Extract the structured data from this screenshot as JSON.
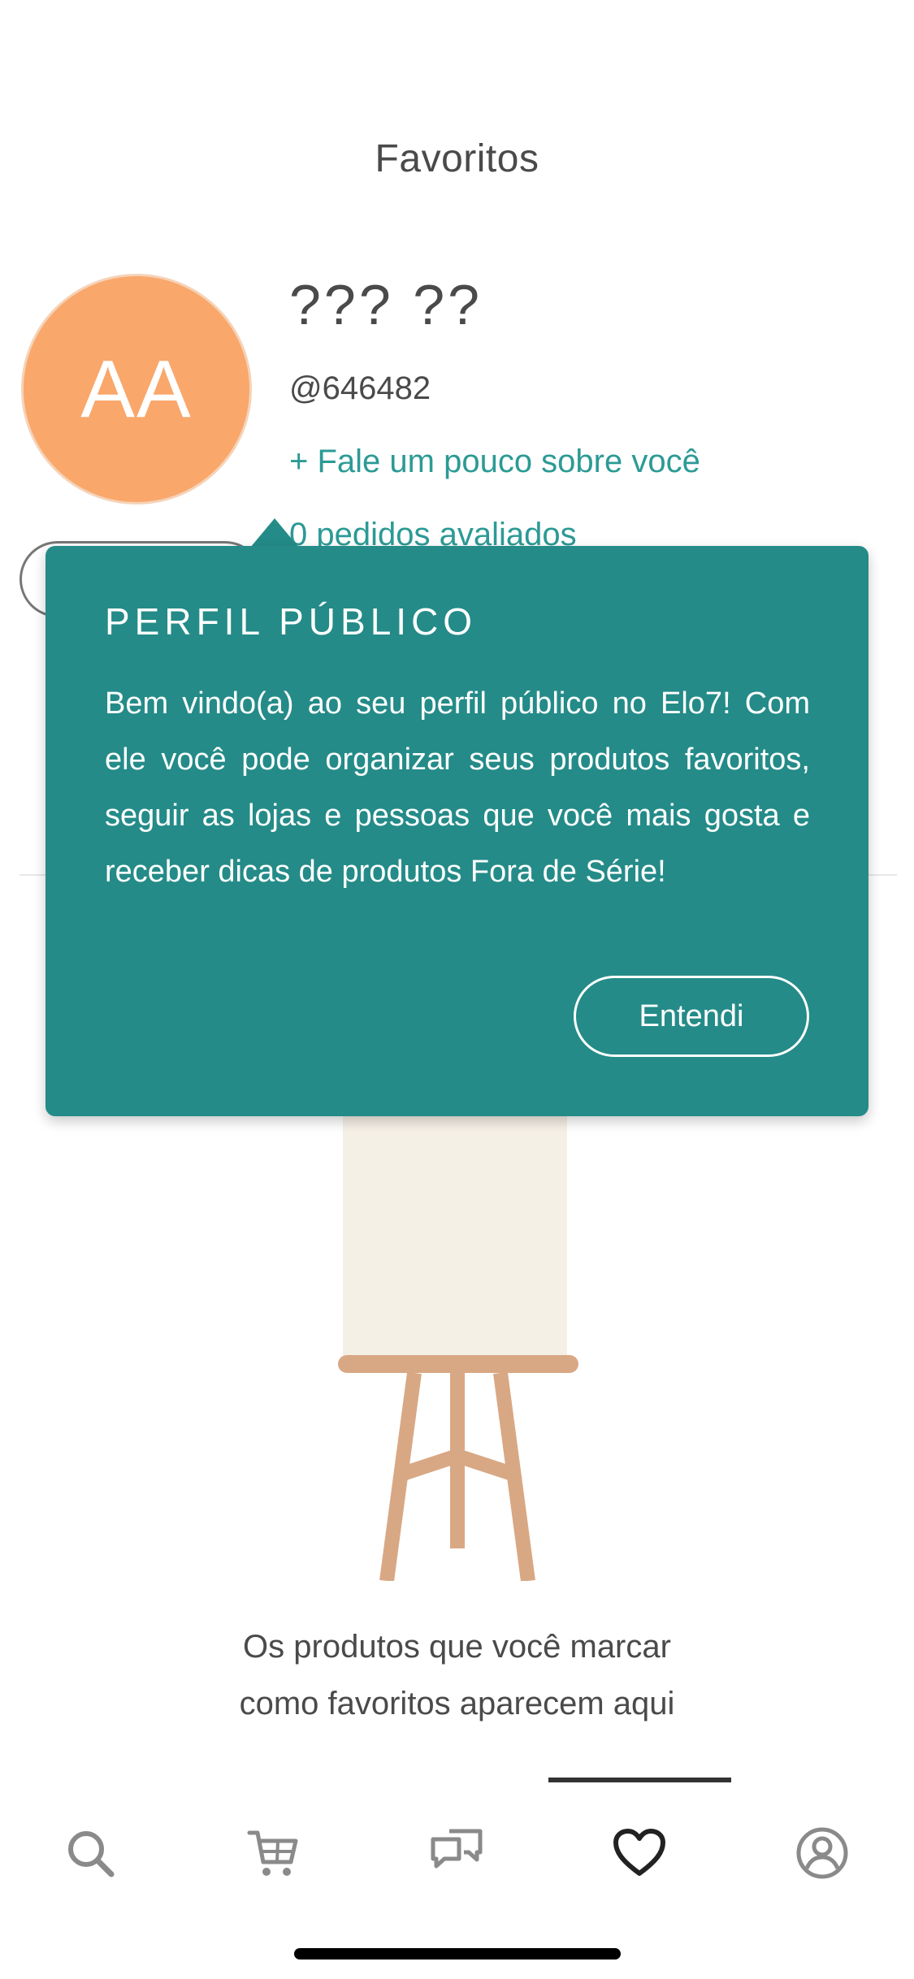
{
  "header": {
    "title": "Favoritos"
  },
  "profile": {
    "avatar_initials": "AA",
    "avatar_color": "#f9a76b",
    "name": "??? ??",
    "handle": "@646482",
    "about_link": "+ Fale um pouco sobre você",
    "reviews_link": "0 pedidos avaliados"
  },
  "tooltip": {
    "title": "PERFIL PÚBLICO",
    "body": "Bem vindo(a) ao seu perfil público no Elo7! Com ele você pode organizar seus produtos favoritos, seguir as lojas e pessoas que você mais gosta e receber dicas de produtos Fora de Série!",
    "button_label": "Entendi",
    "background_color": "#248b88"
  },
  "empty_state": {
    "line1": "Os produtos que você marcar",
    "line2": "como favoritos aparecem aqui"
  },
  "tab_bar": {
    "items": [
      {
        "icon": "search-icon",
        "active": false
      },
      {
        "icon": "cart-icon",
        "active": false
      },
      {
        "icon": "chat-icon",
        "active": false
      },
      {
        "icon": "heart-icon",
        "active": true
      },
      {
        "icon": "profile-icon",
        "active": false
      }
    ]
  },
  "colors": {
    "accent": "#2c9a95",
    "text": "#4a4a4a"
  }
}
